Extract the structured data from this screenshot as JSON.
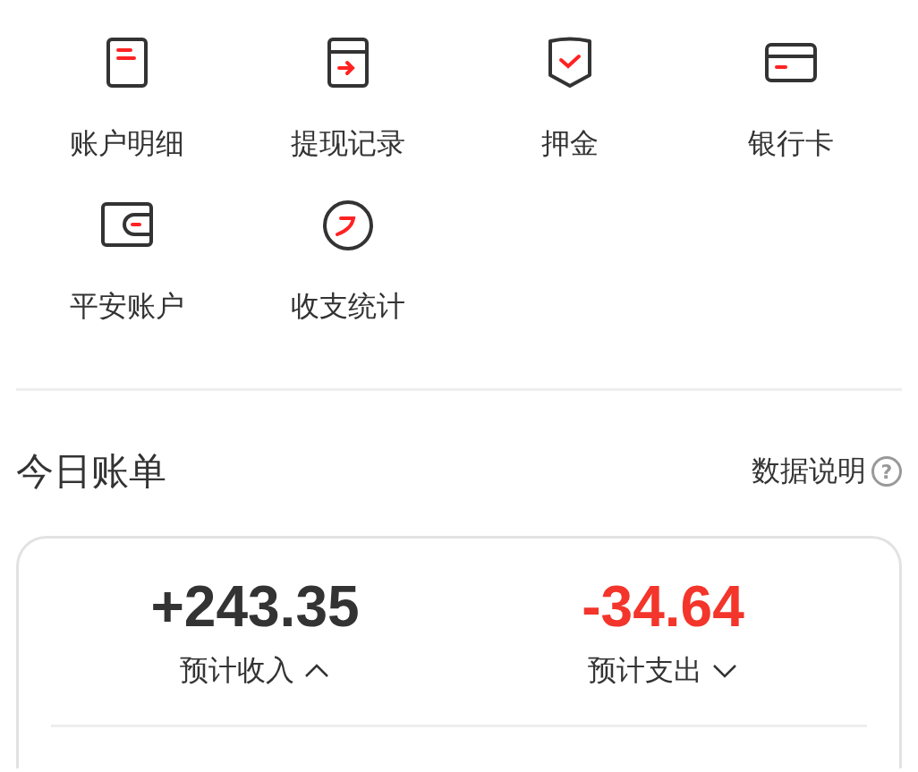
{
  "shortcuts": [
    {
      "label": "账户明细",
      "kind": "document"
    },
    {
      "label": "提现记录",
      "kind": "withdraw"
    },
    {
      "label": "押金",
      "kind": "shield"
    },
    {
      "label": "银行卡",
      "kind": "card"
    },
    {
      "label": "平安账户",
      "kind": "wallet"
    },
    {
      "label": "收支统计",
      "kind": "stats"
    }
  ],
  "bill": {
    "title": "今日账单",
    "help_link": "数据说明",
    "help_icon": "?",
    "items": [
      {
        "amount": "+243.35",
        "label": "预计收入",
        "kind": "income",
        "expanded": true
      },
      {
        "amount": "-34.64",
        "label": "预计支出",
        "kind": "expense",
        "expanded": false
      }
    ]
  }
}
